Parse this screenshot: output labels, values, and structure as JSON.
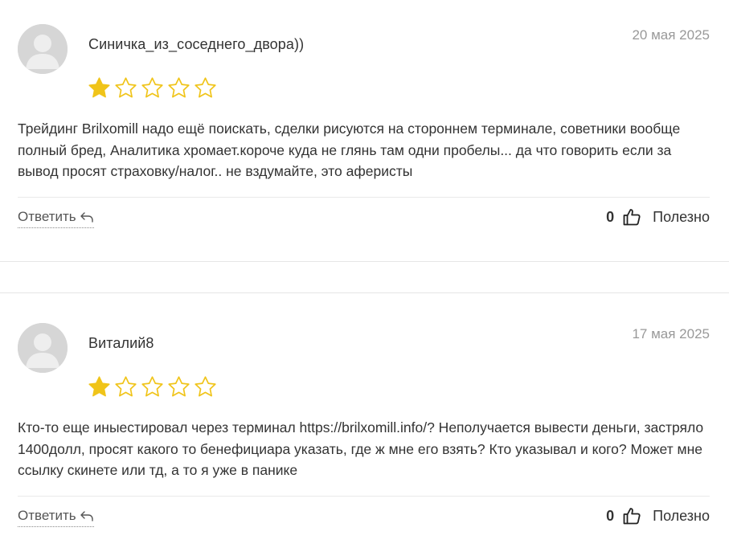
{
  "reviews": [
    {
      "author": "Синичка_из_соседнего_двора))",
      "date": "20 мая 2025",
      "rating": 1,
      "max_rating": 5,
      "text": "Трейдинг Brilxomill надо ещё поискать, сделки рисуются на стороннем терминале, советники вообще полный бред, Аналитика хромает.короче куда не глянь там одни пробелы... да что говорить если за вывод просят страховку/налог.. не вздумайте, это аферисты",
      "reply_label": "Ответить",
      "useful_count": "0",
      "useful_label": "Полезно"
    },
    {
      "author": "Виталий8",
      "date": "17 мая 2025",
      "rating": 1,
      "max_rating": 5,
      "text": "Кто-то еще иныестировал через терминал https://brilxomill.info/? Неполучается вывести деньги, застряло 1400долл, просят какого то бенефициара указать, где ж мне его взять? Кто указывал и кого? Может мне ссылку скинете или тд, а то я уже в панике",
      "reply_label": "Ответить",
      "useful_count": "0",
      "useful_label": "Полезно"
    }
  ],
  "colors": {
    "star_filled": "#f0c419",
    "star_outline": "#f0c419",
    "date": "#999999",
    "avatar_bg": "#d8d8d8"
  },
  "icons": {
    "avatar": "user-silhouette-icon",
    "star": "star-icon",
    "reply": "reply-arrow-icon",
    "like": "thumbs-up-icon"
  }
}
